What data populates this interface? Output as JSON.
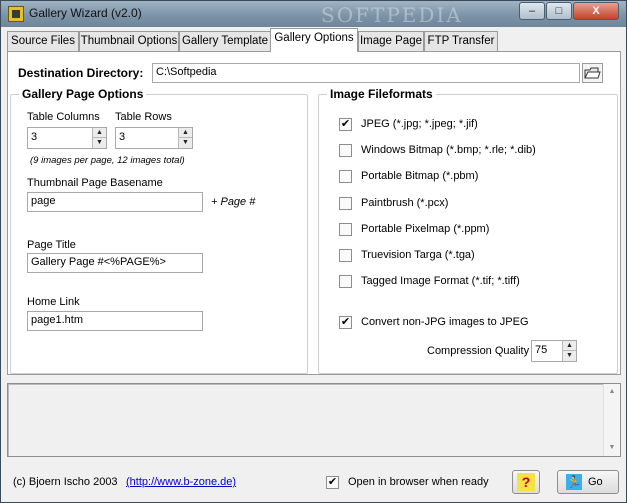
{
  "window": {
    "title": "Gallery Wizard (v2.0)",
    "watermark": "SOFTPEDIA",
    "controls": {
      "minimize": "–",
      "maximize": "□",
      "close": "X"
    }
  },
  "tabs": [
    {
      "label": "Source Files"
    },
    {
      "label": "Thumbnail Options"
    },
    {
      "label": "Gallery Template"
    },
    {
      "label": "Gallery Options",
      "active": true
    },
    {
      "label": "Image Page"
    },
    {
      "label": "FTP Transfer"
    }
  ],
  "destination": {
    "label": "Destination Directory:",
    "value": "C:\\Softpedia"
  },
  "gallery_page_options": {
    "title": "Gallery Page Options",
    "table_columns": {
      "label": "Table Columns",
      "value": "3"
    },
    "table_rows": {
      "label": "Table Rows",
      "value": "3"
    },
    "summary": "(9 images per page, 12 images total)",
    "basename": {
      "label": "Thumbnail Page Basename",
      "value": "page",
      "suffix": "+ Page #"
    },
    "page_title": {
      "label": "Page Title",
      "value": "Gallery Page #<%PAGE%>"
    },
    "home_link": {
      "label": "Home Link",
      "value": "page1.htm"
    }
  },
  "image_fileformats": {
    "title": "Image Fileformats",
    "formats": [
      {
        "label": "JPEG (*.jpg; *.jpeg; *.jif)",
        "mark": "✔"
      },
      {
        "label": "Windows Bitmap (*.bmp; *.rle; *.dib)",
        "mark": ""
      },
      {
        "label": "Portable Bitmap (*.pbm)",
        "mark": ""
      },
      {
        "label": "Paintbrush (*.pcx)",
        "mark": ""
      },
      {
        "label": "Portable Pixelmap (*.ppm)",
        "mark": ""
      },
      {
        "label": "Truevision Targa (*.tga)",
        "mark": ""
      },
      {
        "label": "Tagged Image Format (*.tif; *.tiff)",
        "mark": ""
      }
    ],
    "convert": {
      "label": "Convert non-JPG images to JPEG",
      "mark": "✔"
    },
    "compression": {
      "label": "Compression Quality",
      "value": "75"
    }
  },
  "footer": {
    "copyright": "(c) Bjoern Ischo 2003",
    "link": "(http://www.b-zone.de)",
    "open_browser": {
      "label": "Open in browser when ready",
      "mark": "✔"
    },
    "help_glyph": "?",
    "go_glyph": "🏃",
    "go_label": "Go"
  }
}
